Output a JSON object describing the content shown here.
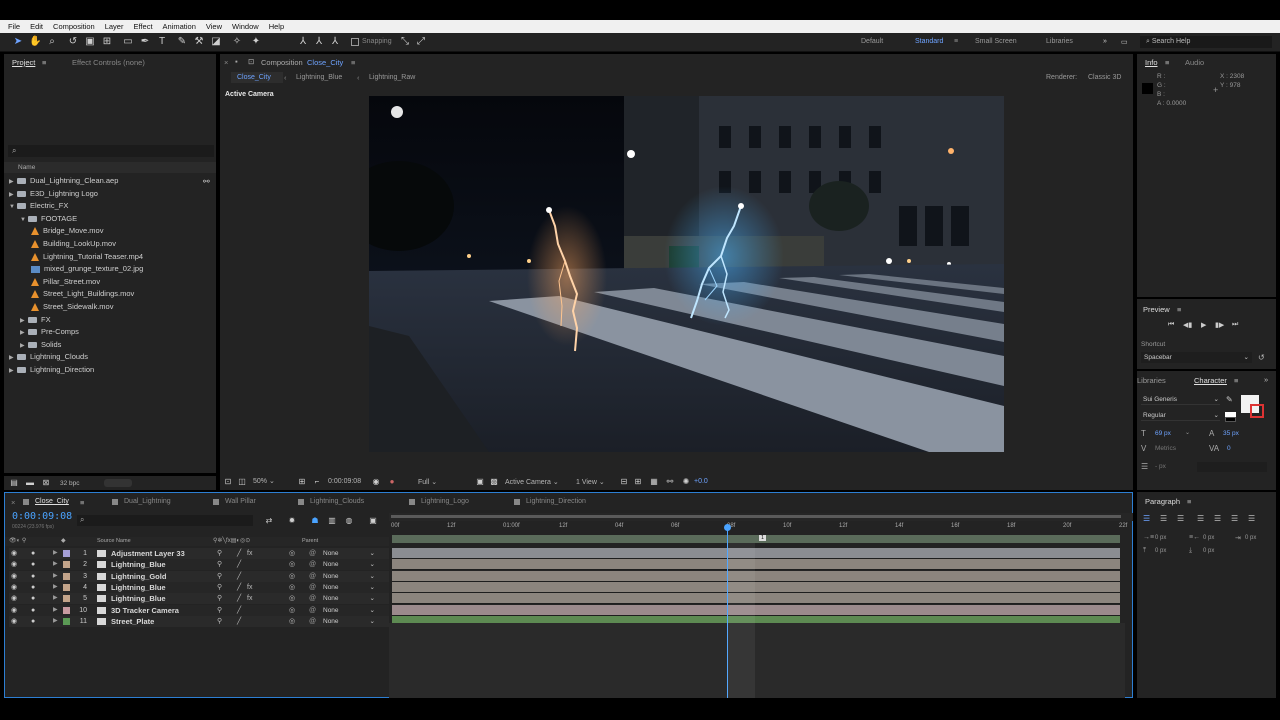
{
  "menu": [
    "File",
    "Edit",
    "Composition",
    "Layer",
    "Effect",
    "Animation",
    "View",
    "Window",
    "Help"
  ],
  "toolbar": {
    "snapping_label": "Snapping",
    "workspaces": [
      "Default",
      "Standard",
      "Small Screen",
      "Libraries"
    ],
    "active_workspace": "Standard",
    "search_placeholder": "Search Help"
  },
  "project": {
    "tab_project": "Project",
    "tab_effect_controls": "Effect Controls (none)",
    "search_icon": "search-icon",
    "column_name": "Name",
    "items": [
      {
        "label": "Dual_Lightning_Clean.aep",
        "type": "folder",
        "indent": 0,
        "open": false
      },
      {
        "label": "E3D_Lightning Logo",
        "type": "folder",
        "indent": 0,
        "open": false
      },
      {
        "label": "Electric_FX",
        "type": "folder",
        "indent": 0,
        "open": true
      },
      {
        "label": "FOOTAGE",
        "type": "folder",
        "indent": 1,
        "open": true
      },
      {
        "label": "Bridge_Move.mov",
        "type": "video",
        "indent": 2
      },
      {
        "label": "Building_LookUp.mov",
        "type": "video",
        "indent": 2
      },
      {
        "label": "Lightning_Tutorial Teaser.mp4",
        "type": "video",
        "indent": 2
      },
      {
        "label": "mixed_grunge_texture_02.jpg",
        "type": "image",
        "indent": 2
      },
      {
        "label": "Pillar_Street.mov",
        "type": "video",
        "indent": 2
      },
      {
        "label": "Street_Light_Buildings.mov",
        "type": "video",
        "indent": 2
      },
      {
        "label": "Street_Sidewalk.mov",
        "type": "video",
        "indent": 2
      },
      {
        "label": "FX",
        "type": "folder",
        "indent": 1,
        "open": false
      },
      {
        "label": "Pre-Comps",
        "type": "folder",
        "indent": 1,
        "open": false
      },
      {
        "label": "Solids",
        "type": "folder",
        "indent": 1,
        "open": false
      },
      {
        "label": "Lightning_Clouds",
        "type": "folder",
        "indent": 0,
        "open": false
      },
      {
        "label": "Lightning_Direction",
        "type": "folder",
        "indent": 0,
        "open": false
      }
    ],
    "bpc": "32 bpc"
  },
  "composition": {
    "panel_title_prefix": "Composition",
    "panel_title_name": "Close_City",
    "breadcrumbs": [
      "Close_City",
      "Lightning_Blue",
      "Lightning_Raw"
    ],
    "renderer_label": "Renderer:",
    "renderer_value": "Classic 3D",
    "active_camera_label": "Active Camera",
    "zoom": "50%",
    "timecode": "0:00:09:08",
    "resolution": "Full",
    "view_camera": "Active Camera",
    "view_count": "1 View",
    "exposure": "+0.0"
  },
  "info": {
    "tab_info": "Info",
    "tab_audio": "Audio",
    "r": "R :",
    "g": "G :",
    "b": "B :",
    "a": "A : 0.0000",
    "x": "X : 2308",
    "y": "Y : 978"
  },
  "preview": {
    "title": "Preview",
    "shortcut_label": "Shortcut",
    "shortcut_value": "Spacebar"
  },
  "character": {
    "tab_libraries": "Libraries",
    "tab_character": "Character",
    "font": "Sui Generis",
    "style": "Regular",
    "size": "69 px",
    "leading": "35 px",
    "kerning": "Metrics",
    "tracking": "0",
    "stroke": "- px"
  },
  "paragraph": {
    "title": "Paragraph",
    "indent_values": [
      "0 px",
      "0 px",
      "0 px",
      "0 px",
      "0 px"
    ]
  },
  "timeline": {
    "tabs": [
      "Close_City",
      "Dual_Lightning",
      "Wall Pillar",
      "Lightning_Clouds",
      "Lightning_Logo",
      "Lightning_Direction"
    ],
    "timecode": "0:00:09:08",
    "fps_sub": "00224 (23.976 fps)",
    "col_source": "Source Name",
    "col_parent": "Parent",
    "ruler": [
      "00f",
      "12f",
      "01:00f",
      "12f",
      "04f",
      "06f",
      "08f",
      "10f",
      "12f",
      "14f",
      "16f",
      "18f",
      "20f",
      "22f"
    ],
    "layers": [
      {
        "num": "1",
        "name": "Adjustment Layer 33",
        "color": "#a59fd6",
        "parent": "None",
        "fx": true,
        "bar": "#8b8d92"
      },
      {
        "num": "2",
        "name": "Lightning_Blue",
        "color": "#c3a48a",
        "parent": "None",
        "fx": false,
        "bar": "#8c857e"
      },
      {
        "num": "3",
        "name": "Lightning_Gold",
        "color": "#c3a48a",
        "parent": "None",
        "fx": false,
        "bar": "#8c857e"
      },
      {
        "num": "4",
        "name": "Lightning_Blue",
        "color": "#c3a48a",
        "parent": "None",
        "fx": true,
        "bar": "#8c857e"
      },
      {
        "num": "5",
        "name": "Lightning_Blue",
        "color": "#c3a48a",
        "parent": "None",
        "fx": true,
        "bar": "#8c857e"
      },
      {
        "num": "10",
        "name": "3D Tracker Camera",
        "color": "#c79aa0",
        "parent": "None",
        "fx": false,
        "bar": "#9b8a8c"
      },
      {
        "num": "11",
        "name": "Street_Plate",
        "color": "#5b9a55",
        "parent": "None",
        "fx": false,
        "bar": "#5d8a52"
      }
    ]
  },
  "colors": {
    "accent": "#2d8ceb",
    "panel": "#232323",
    "menubar": "#f0f0f0"
  }
}
